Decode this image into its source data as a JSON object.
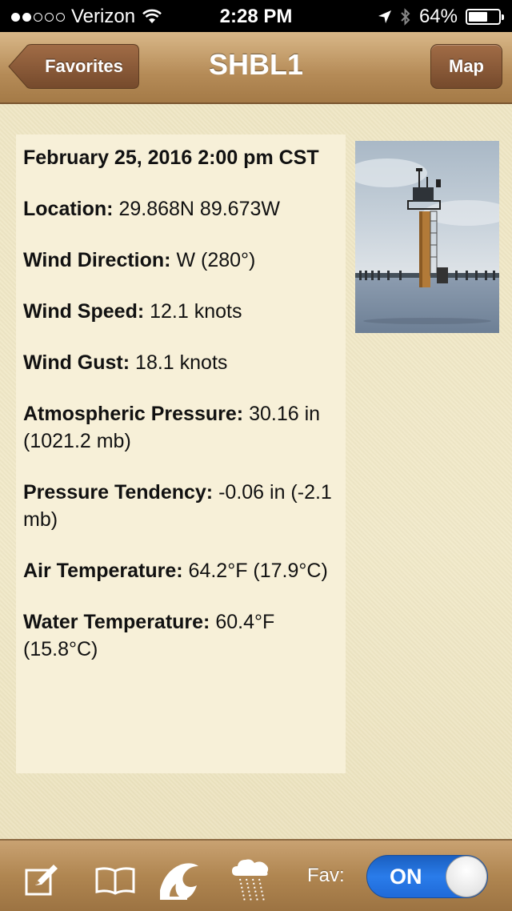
{
  "status_bar": {
    "carrier": "Verizon",
    "time": "2:28 PM",
    "battery": "64%",
    "battery_level": 0.64
  },
  "nav": {
    "back_label": "Favorites",
    "title": "SHBL1",
    "map_label": "Map"
  },
  "observation": {
    "date": "February 25, 2016 2:00 pm CST",
    "fields": [
      {
        "key": "Location:",
        "value": "29.868N 89.673W"
      },
      {
        "key": "Wind Direction:",
        "value": "W (280°)"
      },
      {
        "key": "Wind Speed:",
        "value": "12.1 knots"
      },
      {
        "key": "Wind Gust:",
        "value": "18.1 knots"
      },
      {
        "key": "Atmospheric Pressure:",
        "value": "30.16 in (1021.2 mb)"
      },
      {
        "key": "Pressure Tendency:",
        "value": "-0.06 in (-2.1 mb)"
      },
      {
        "key": "Air Temperature:",
        "value": "64.2°F (17.9°C)"
      },
      {
        "key": "Water Temperature:",
        "value": "60.4°F (15.8°C)"
      }
    ]
  },
  "toolbar": {
    "icons": [
      "compose-icon",
      "book-icon",
      "wave-icon",
      "rain-cloud-icon"
    ],
    "fav_label": "Fav:",
    "fav_toggle": "ON"
  },
  "colors": {
    "nav_brown": "#b58b57",
    "panel_bg": "#f7f0d8",
    "toggle_blue": "#2a7cea"
  }
}
